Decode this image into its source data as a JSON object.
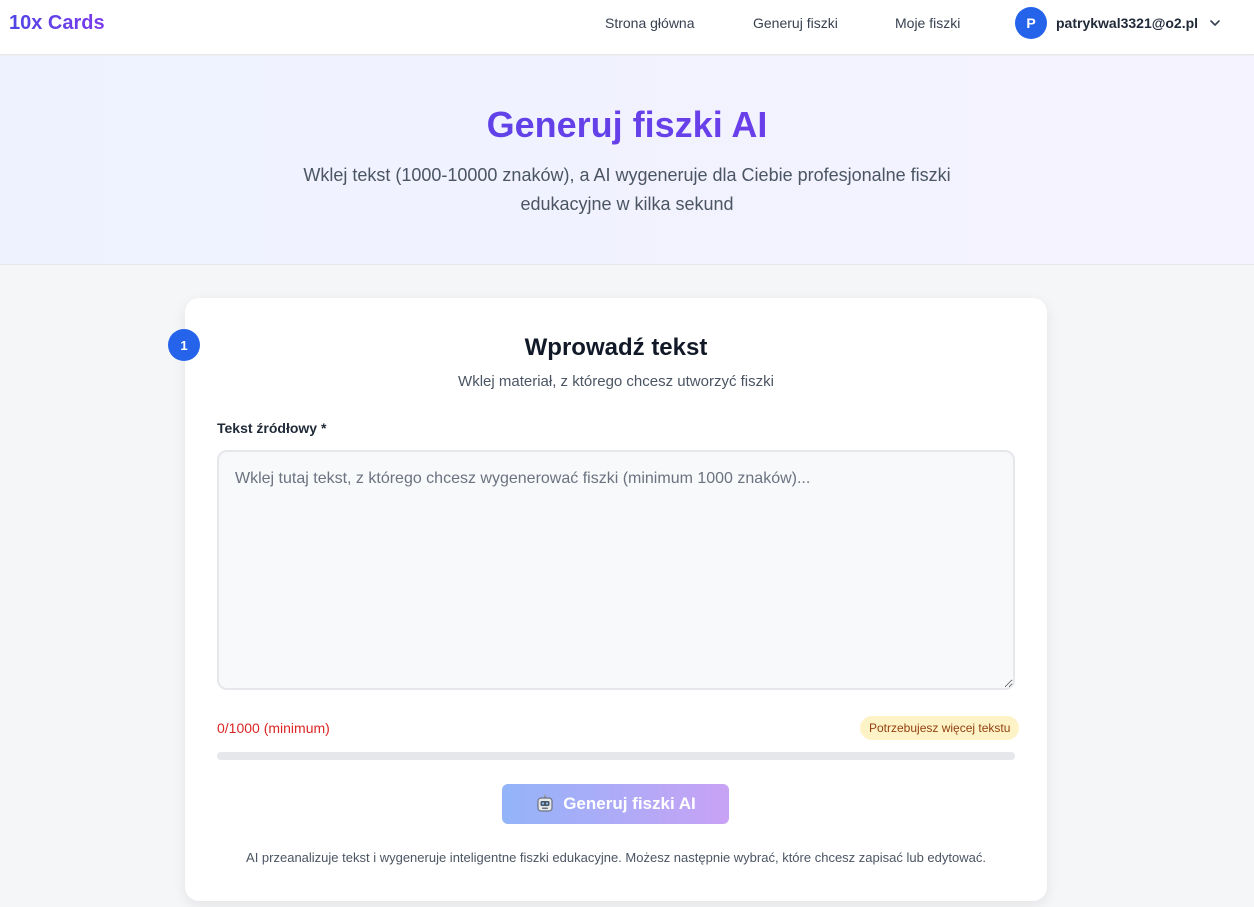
{
  "nav": {
    "logo": "10x Cards",
    "links": [
      {
        "label": "Strona główna"
      },
      {
        "label": "Generuj fiszki"
      },
      {
        "label": "Moje fiszki"
      }
    ],
    "user": {
      "initial": "P",
      "email": "patrykwal3321@o2.pl",
      "icon": "chevron-down-icon"
    }
  },
  "hero": {
    "title": "Generuj fiszki AI",
    "subtitle": "Wklej tekst (1000-10000 znaków), a AI wygeneruje dla Ciebie profesjonalne fiszki edukacyjne w kilka sekund"
  },
  "form": {
    "step": "1",
    "title": "Wprowadź tekst",
    "subtitle": "Wklej materiał, z którego chcesz utworzyć fiszki",
    "label": "Tekst źródłowy *",
    "value": "",
    "placeholder": "Wklej tutaj tekst, z którego chcesz wygenerować fiszki (minimum 1000 znaków)...",
    "counter": "0/1000 (minimum)",
    "badge": "Potrzebujesz więcej tekstu",
    "progress": 0,
    "button": {
      "label": "Generuj fiszki AI",
      "icon": "robot-icon",
      "disabled": true
    },
    "note": "AI przeanalizuje tekst i wygeneruje inteligentne fiszki edukacyjne. Możesz następnie wybrać, które chcesz zapisać lub edytować."
  },
  "colors": {
    "accent": "#2563eb",
    "brand_from": "#4f46e5",
    "brand_to": "#7c3aed",
    "error": "#dc2626",
    "warning_bg": "#fef3c7"
  }
}
